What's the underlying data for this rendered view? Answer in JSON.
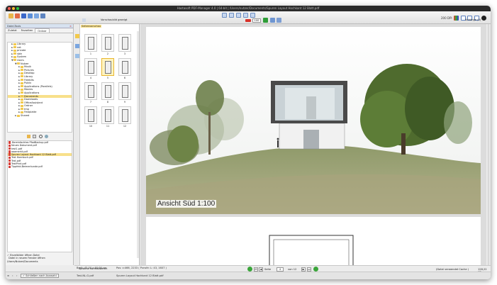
{
  "window": {
    "title": "Hastasoft PDF-Manager 4.0 | 64-bit | /Users/nutzer/Documents/Spuren Layout Hochkant 12 Blatt.pdf"
  },
  "toolbar": {
    "zoom_value": "100",
    "dpi_label": "200 DPI",
    "anzeige_label": "Anzeige"
  },
  "left_panel": {
    "header": "Datei-Tools",
    "tabs": [
      "Zuletzt",
      "Favoriten",
      "Ordner"
    ],
    "tree": [
      {
        "label": "Library",
        "level": 1,
        "arrow": "►"
      },
      {
        "label": "net",
        "level": 1,
        "arrow": "►"
      },
      {
        "label": "private",
        "level": 1,
        "arrow": "►"
      },
      {
        "label": "sbin",
        "level": 1,
        "arrow": "►"
      },
      {
        "label": "System",
        "level": 1,
        "arrow": "►"
      },
      {
        "label": "Users",
        "level": 1,
        "arrow": "▼"
      },
      {
        "label": "Nutzer",
        "level": 2,
        "arrow": "▼"
      },
      {
        "label": "Musik",
        "level": 3,
        "arrow": "►"
      },
      {
        "label": "Pictures",
        "level": 3,
        "arrow": "►"
      },
      {
        "label": "Desktop",
        "level": 3,
        "arrow": "►"
      },
      {
        "label": "Library",
        "level": 3,
        "arrow": "►"
      },
      {
        "label": "Freebits",
        "level": 3,
        "arrow": "►"
      },
      {
        "label": "Public",
        "level": 3,
        "arrow": "►"
      },
      {
        "label": "Applications (Parallels)",
        "level": 3,
        "arrow": "►"
      },
      {
        "label": "Movies",
        "level": 3,
        "arrow": "►"
      },
      {
        "label": "Applications",
        "level": 3,
        "arrow": "►"
      },
      {
        "label": "Documents",
        "level": 3,
        "arrow": "►",
        "selected": true
      },
      {
        "label": "Downloads",
        "level": 3,
        "arrow": "►"
      },
      {
        "label": "OfficeAssistant",
        "level": 3,
        "arrow": "►"
      },
      {
        "label": "Ordner",
        "level": 3,
        "arrow": "►"
      },
      {
        "label": "tmp",
        "level": 3,
        "arrow": "►"
      },
      {
        "label": "Festplatte",
        "level": 3,
        "arrow": "►"
      },
      {
        "label": "Shared",
        "level": 2,
        "arrow": "►"
      }
    ],
    "files": [
      {
        "label": ".Bereinfachtes PfadBackup.pdf"
      },
      {
        "label": "Neues Dokument.pdf"
      },
      {
        "label": "test1.pdf"
      },
      {
        "label": "aaamerkt.pdf"
      },
      {
        "label": "Spuren Layout Hochkant 12 Blatt.pdf",
        "selected": true
      },
      {
        "label": "Test Hoerbuch.pdf"
      },
      {
        "label": "Test.pdf"
      },
      {
        "label": "TestPrint.pdf"
      },
      {
        "label": "Tippfeld-Beimerkunde.pdf"
      }
    ],
    "footer_opt1": "Einzelbilder öffnen Datei",
    "footer_opt2": "Datei in neuem Fenster öffnen",
    "footer_path": "/Users/Nutzer/Documents",
    "footer_btn": "Schließen nach Auswahl"
  },
  "thumbs": {
    "header_check": "Vorschau gleich der Liste",
    "tab_label": "Seitenvorschau",
    "numbers": [
      "1",
      "2",
      "3",
      "4",
      "5",
      "6",
      "7",
      "8",
      "9",
      "10",
      "11",
      "12"
    ],
    "selected_index": 4
  },
  "doc_toolbar": {
    "checkbox_label": "Vorschaubild gezeigt",
    "right_label": "Anhänge (0)"
  },
  "document": {
    "caption": "Ansicht Süd 1:100"
  },
  "navbar": {
    "left_label": "Sprache normalisieren",
    "page_label": "Seite",
    "page_value": "4",
    "of_label": "von 12",
    "cache_label": "(Datei verwendet Cache )",
    "size_label": "128,22 KB"
  },
  "status": {
    "dimensions": "Breit: 42,00 x 60,00 cm",
    "position": "Pos: x:466, 2233 ( Pxnsfe: L: 43, 1607 )",
    "file_label": "Spuren Layout Hochkant 12 Blatt.pdf",
    "left_file": "Test-NL-G.pdf"
  }
}
